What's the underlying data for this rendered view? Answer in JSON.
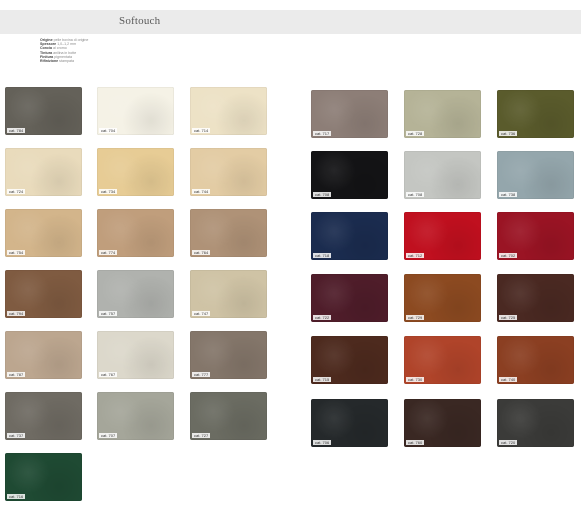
{
  "title": "Softouch",
  "specs": [
    {
      "key": "Origine",
      "value": "pelle bovina di origine"
    },
    {
      "key": "Spessore",
      "value": "1,0–1,2 mm"
    },
    {
      "key": "Concia",
      "value": "al cromo"
    },
    {
      "key": "Tintura",
      "value": "anilina in botte"
    },
    {
      "key": "Finitura",
      "value": "pigmentata"
    },
    {
      "key": "Rifinizione",
      "value": "stampata"
    }
  ],
  "swatches_left": [
    {
      "code": "cat. 784",
      "color": "#646159"
    },
    {
      "code": "cat. 704",
      "color": "#f5f2e6"
    },
    {
      "code": "cat. 714",
      "color": "#ede2c6"
    },
    {
      "code": "cat. 724",
      "color": "#e9dbbc"
    },
    {
      "code": "cat. 734",
      "color": "#e7cc95"
    },
    {
      "code": "cat. 744",
      "color": "#e3cca4"
    },
    {
      "code": "cat. 754",
      "color": "#d3b58b"
    },
    {
      "code": "cat. 774",
      "color": "#c09e7c"
    },
    {
      "code": "cat. 764",
      "color": "#af9277"
    },
    {
      "code": "cat. 794",
      "color": "#7f5b41"
    },
    {
      "code": "cat. 757",
      "color": "#b0b2ae"
    },
    {
      "code": "cat. 747",
      "color": "#cfc3a5"
    },
    {
      "code": "cat. 787",
      "color": "#bca68f"
    },
    {
      "code": "cat. 767",
      "color": "#dcd8cb"
    },
    {
      "code": "cat. 777",
      "color": "#84766a"
    },
    {
      "code": "cat. 737",
      "color": "#6f6b63"
    },
    {
      "code": "cat. 707",
      "color": "#a5a69a"
    },
    {
      "code": "cat. 727",
      "color": "#6b6c62"
    },
    {
      "code": "cat. 716",
      "color": "#1f4a33"
    }
  ],
  "swatches_right": [
    {
      "code": "cat. 717",
      "color": "#8d7e77"
    },
    {
      "code": "cat. 728",
      "color": "#b5b397"
    },
    {
      "code": "cat. 736",
      "color": "#5a5b2c"
    },
    {
      "code": "cat. 708",
      "color": "#141416"
    },
    {
      "code": "cat. 708",
      "color": "#c4c6c2"
    },
    {
      "code": "cat. 738",
      "color": "#94a6ac"
    },
    {
      "code": "cat. 718",
      "color": "#1b2c4f"
    },
    {
      "code": "cat. 712",
      "color": "#c0101f"
    },
    {
      "code": "cat. 702",
      "color": "#9a1424"
    },
    {
      "code": "cat. 722",
      "color": "#4f1d2a"
    },
    {
      "code": "cat. 729",
      "color": "#8c4a21"
    },
    {
      "code": "cat. 725",
      "color": "#4a2922"
    },
    {
      "code": "cat. 715",
      "color": "#4d2a1e"
    },
    {
      "code": "cat. 730",
      "color": "#b0442a"
    },
    {
      "code": "cat. 740",
      "color": "#8b3f22"
    },
    {
      "code": "cat. 706",
      "color": "#25292b"
    },
    {
      "code": "cat. 760",
      "color": "#3a2823"
    },
    {
      "code": "cat. 720",
      "color": "#3b3b39"
    }
  ]
}
